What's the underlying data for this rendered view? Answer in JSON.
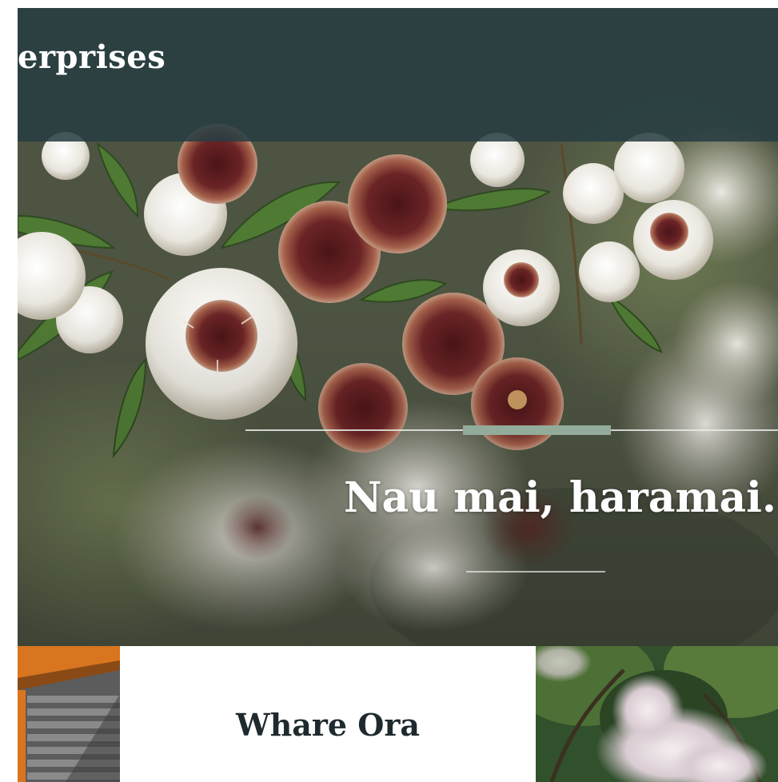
{
  "header": {
    "brand": "erprises"
  },
  "hero": {
    "heading": "Nau mai, haramai."
  },
  "cards": {
    "center_title": "Whare Ora"
  },
  "colors": {
    "top_bar": "#263d42",
    "accent_rule": "#93ab9a",
    "heading_text": "#ffffff",
    "card_title_text": "#1f2a2e"
  }
}
